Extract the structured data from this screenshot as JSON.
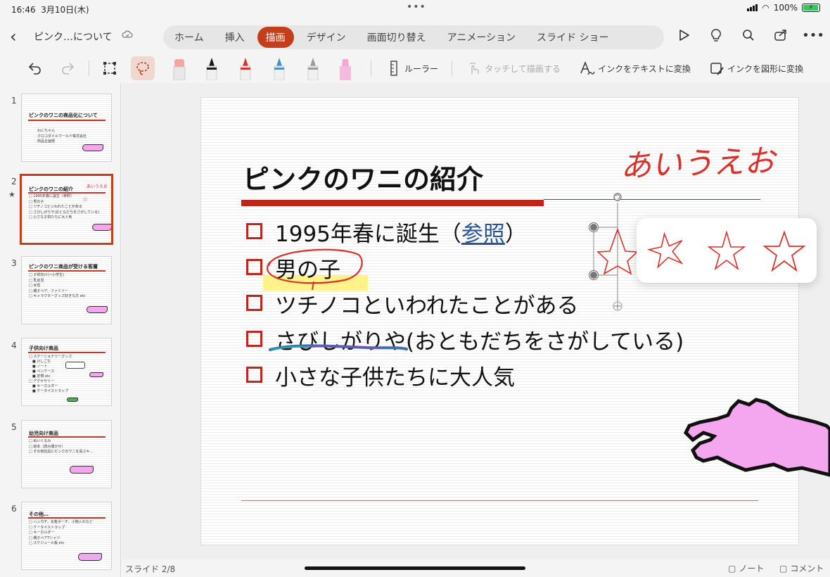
{
  "status_bar": {
    "time": "16:46",
    "date": "3月10日(木)",
    "dots": "•••",
    "battery": "100%",
    "battery_level": 1.0
  },
  "app": {
    "document_title": "ピンク…について",
    "tabs": [
      {
        "label": "ホーム",
        "active": false
      },
      {
        "label": "挿入",
        "active": false
      },
      {
        "label": "描画",
        "active": true
      },
      {
        "label": "デザイン",
        "active": false
      },
      {
        "label": "画面切り替え",
        "active": false
      },
      {
        "label": "アニメーション",
        "active": false
      },
      {
        "label": "スライド ショー",
        "active": false
      }
    ],
    "top_icons": [
      "play-icon",
      "lightbulb-icon",
      "search-icon",
      "share-icon",
      "more-icon"
    ],
    "accent_color": "#c43e1c"
  },
  "toolbar": {
    "ruler_label": "ルーラー",
    "touch_draw_label": "タッチして描画する",
    "ink_to_text_label": "インクをテキストに変換",
    "ink_to_shape_label": "インクを図形に変換",
    "pens": [
      {
        "name": "eraser",
        "color": "#f2a7a4"
      },
      {
        "name": "pen-black",
        "color": "#1a1a1a"
      },
      {
        "name": "pen-red",
        "color": "#d9312b"
      },
      {
        "name": "pen-galaxy",
        "color": "#4a90c8"
      },
      {
        "name": "pencil-gray",
        "color": "#9a9a9a"
      },
      {
        "name": "highlighter-pink",
        "color": "#f6a7d7"
      }
    ]
  },
  "thumbnails": [
    {
      "num": "1",
      "title": "ピンクのワニの商品化について",
      "bullets": [
        "わにちゃん",
        "クロコダイルワールド株式会社",
        "商品企画部"
      ]
    },
    {
      "num": "2",
      "title": "ピンクのワニの紹介",
      "handwriting": "あいうえお",
      "star": "☆",
      "bullets": [
        "□ 1995年春に誕生（参照）",
        "□ 男の子",
        "□ ツチノコといわれたことがある",
        "□ さびしがりや(おともだちをさがしている)",
        "□ 小さな子供たちに大人気"
      ]
    },
    {
      "num": "3",
      "title": "ピンクのワニ商品が受ける客層",
      "bullets": [
        "□ 子供向け(～小学生)",
        "□ 乳幼児",
        "□ 女性",
        "□ 親子ペア、ファミリー",
        "□ キャラクターグッズ好きな方 etc"
      ]
    },
    {
      "num": "4",
      "title": "子供向け商品",
      "bullets": [
        "□ ステーショナリーグッズ",
        "　■ けしごむ",
        "　■ ノート",
        "　■ ペンケース",
        "　■ 定規 etc",
        "□ アクセサリー",
        "　■ キーホルダー",
        "　■ ケータイストラップ"
      ]
    },
    {
      "num": "5",
      "title": "幼児向け商品",
      "bullets": [
        "□ ぬいぐるみ",
        "□ 絵本（読み聞かせ）",
        "□ その他玩具にピンクのワニを喜ぶキ…"
      ]
    },
    {
      "num": "6",
      "title": "その他…",
      "bullets": [
        "□ ハンカチ、化粧ポーチ、小物入れなど",
        "□ ケータイストラップ",
        "□ キーホルダー",
        "□ 親子ペアTシャツ",
        "□ スケジュール帳 etc"
      ]
    }
  ],
  "slide": {
    "title": "ピンクのワニの紹介",
    "bullets": [
      {
        "pre": "1995年春に誕生（",
        "link": "参照",
        "post": "）"
      },
      {
        "pre": "男の子",
        "link": "",
        "post": ""
      },
      {
        "pre": "ツチノコといわれたことがある",
        "link": "",
        "post": ""
      },
      {
        "pre": "さびしがりや(おともだちをさがしている)",
        "link": "",
        "post": ""
      },
      {
        "pre": "小さな子供たちに大人気",
        "link": "",
        "post": ""
      }
    ],
    "handwriting": "あいうえお"
  },
  "footer": {
    "slide_count": "スライド 2/8",
    "notes_label": "ノート",
    "comments_label": "コメント"
  }
}
